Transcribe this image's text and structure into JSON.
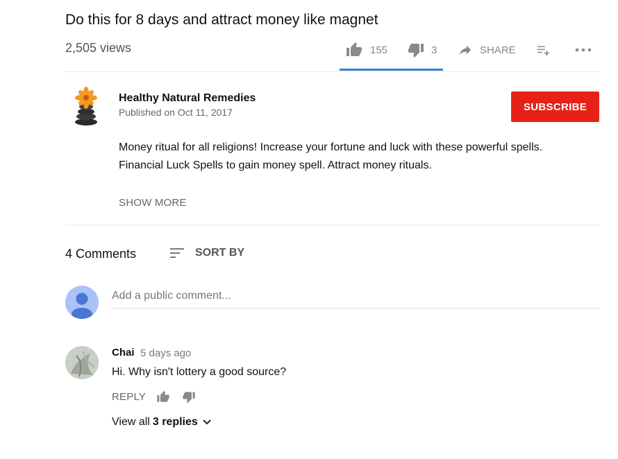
{
  "video": {
    "title": "Do this for 8 days and attract money like magnet",
    "views": "2,505 views"
  },
  "actions": {
    "like_count": "155",
    "dislike_count": "3",
    "share_label": "SHARE",
    "like_icon": "thumb-up-icon",
    "dislike_icon": "thumb-down-icon",
    "share_icon": "share-arrow-icon",
    "save_icon": "add-to-playlist-icon",
    "more_icon": "more-horizontal-icon",
    "sentiment_bar_color": "#3a7bd5"
  },
  "channel": {
    "name": "Healthy Natural Remedies",
    "published": "Published on Oct 11, 2017",
    "subscribe_label": "SUBSCRIBE",
    "subscribe_color": "#e62117"
  },
  "description": {
    "line1": "Money ritual for all religions! Increase your fortune and luck with these powerful spells.",
    "line2": "Financial Luck Spells to gain money spell. Attract money rituals.",
    "show_more": "SHOW MORE"
  },
  "comments": {
    "count_label": "4 Comments",
    "sort_label": "SORT BY",
    "input_placeholder": "Add a public comment...",
    "items": [
      {
        "author": "Chai",
        "time": "5 days ago",
        "text": "Hi. Why isn't lottery a good source?",
        "reply_label": "REPLY",
        "view_replies_prefix": "View all",
        "view_replies_strong": "3 replies"
      }
    ]
  }
}
